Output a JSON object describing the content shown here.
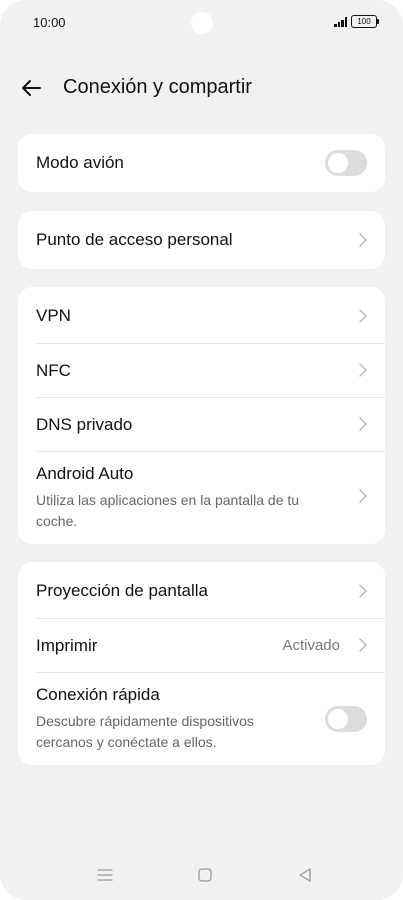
{
  "status_bar": {
    "time": "10:00",
    "battery": "100"
  },
  "header": {
    "title": "Conexión y compartir"
  },
  "groups": {
    "airplane": {
      "label": "Modo avión",
      "toggle_on": false
    },
    "hotspot": {
      "label": "Punto de acceso personal"
    },
    "network": {
      "vpn": "VPN",
      "nfc": "NFC",
      "dns": "DNS privado",
      "android_auto": {
        "label": "Android Auto",
        "description": "Utiliza las aplicaciones en la pantalla de tu coche."
      }
    },
    "devices": {
      "projection": "Proyección de pantalla",
      "print": {
        "label": "Imprimir",
        "value": "Activado"
      },
      "quick_connect": {
        "label": "Conexión rápida",
        "description": "Descubre rápidamente dispositivos cercanos y conéctate a ellos.",
        "toggle_on": false
      }
    }
  },
  "colors": {
    "background": "#f1f1f3",
    "card": "#ffffff",
    "toggle_off": "#dcdcde",
    "secondary_text": "#666666"
  },
  "nav_icons": [
    "menu-icon",
    "home-square-icon",
    "back-triangle-icon"
  ]
}
